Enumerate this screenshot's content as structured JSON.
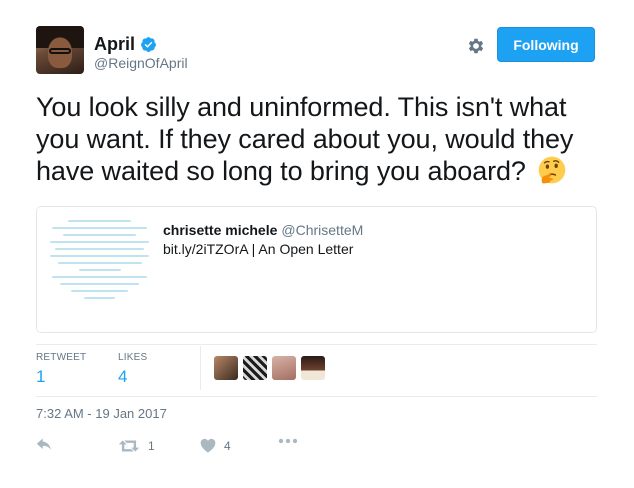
{
  "author": {
    "display_name": "April",
    "handle": "@ReignOfApril",
    "verified": true
  },
  "follow_button": {
    "label": "Following"
  },
  "tweet": {
    "text": "You look silly and uninformed. This isn't what you want. If they cared about you, would they have waited so long to bring you aboard?",
    "emoji": "thinking-face"
  },
  "quoted_card": {
    "author_name": "chrisette michele",
    "author_handle": "@ChrisetteM",
    "description": "bit.ly/2iTZOrA | An Open Letter"
  },
  "stats": {
    "retweets_label": "RETWEET",
    "retweets_count": "1",
    "likes_label": "LIKES",
    "likes_count": "4"
  },
  "likers": [
    "liker-avatar-1",
    "liker-avatar-2",
    "liker-avatar-3",
    "liker-avatar-4"
  ],
  "timestamp": "7:32 AM - 19 Jan 2017",
  "actions": {
    "retweet_count": "1",
    "like_count": "4"
  },
  "colors": {
    "accent": "#1da1f2",
    "secondary_text": "#657786",
    "border": "#e1e8ed"
  }
}
